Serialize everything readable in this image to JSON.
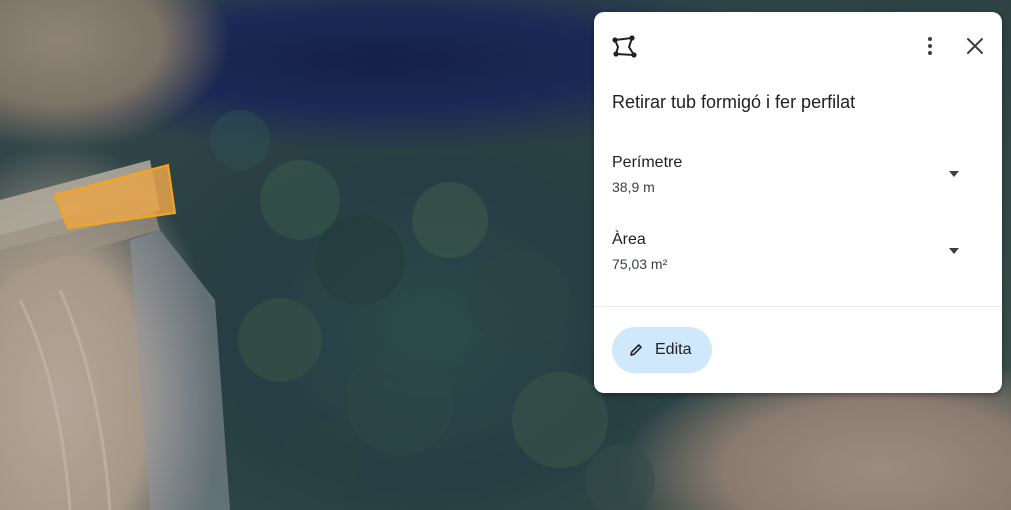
{
  "map": {
    "background": "satellite",
    "polygon_fill": "#e8a44a",
    "polygon_stroke": "#f3a51c"
  },
  "panel": {
    "icon": "polygon-shape-icon",
    "title": "Retirar tub formigó i fer perfilat",
    "measurements": [
      {
        "label": "Perímetre",
        "value": "38,9 m"
      },
      {
        "label": "Àrea",
        "value": "75,03 m²"
      }
    ],
    "edit_label": "Edita",
    "accent": "#cfe8fb"
  }
}
